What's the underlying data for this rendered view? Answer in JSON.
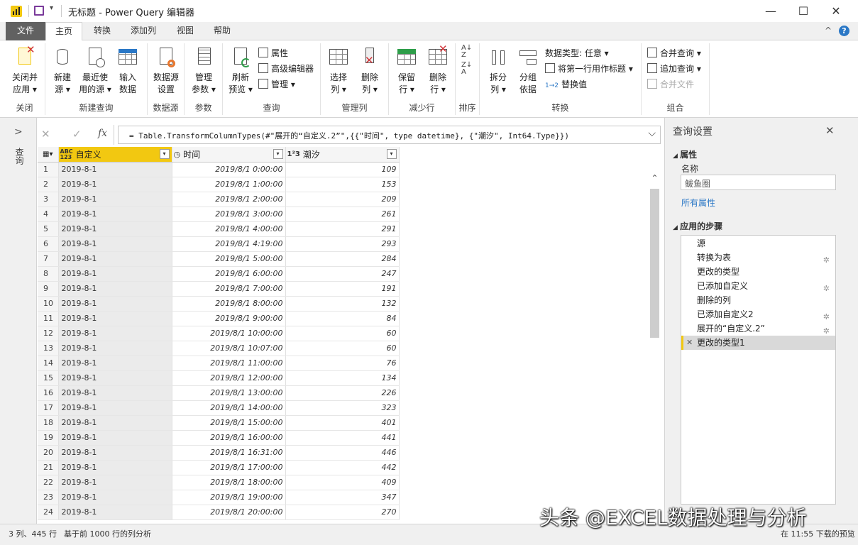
{
  "window": {
    "title": "无标题 - Power Query 编辑器",
    "controls": {
      "minimize": "—",
      "maximize": "☐",
      "close": "✕"
    }
  },
  "menu": {
    "tabs": [
      "文件",
      "主页",
      "转换",
      "添加列",
      "视图",
      "帮助"
    ],
    "active": "主页",
    "collapse": "^",
    "help": "?"
  },
  "ribbon": {
    "groups": {
      "close": "关闭",
      "new_query": "新建查询",
      "data_source": "数据源",
      "parameters": "参数",
      "query": "查询",
      "manage_columns": "管理列",
      "reduce_rows": "减少行",
      "sort": "排序",
      "transform": "转换",
      "combine": "组合"
    },
    "buttons": {
      "close_apply": [
        "关闭并",
        "应用 ▾"
      ],
      "new_source": [
        "新建",
        "源 ▾"
      ],
      "recent_sources": [
        "最近使",
        "用的源 ▾"
      ],
      "enter_data": [
        "输入",
        "数据"
      ],
      "data_source_settings": [
        "数据源",
        "设置"
      ],
      "manage_parameters": [
        "管理",
        "参数 ▾"
      ],
      "refresh_preview": [
        "刷新",
        "预览 ▾"
      ],
      "properties": "属性",
      "advanced_editor": "高级编辑器",
      "manage": "管理 ▾",
      "choose_columns": [
        "选择",
        "列 ▾"
      ],
      "remove_columns": [
        "删除",
        "列 ▾"
      ],
      "keep_rows": [
        "保留",
        "行 ▾"
      ],
      "remove_rows": [
        "删除",
        "行 ▾"
      ],
      "split_column": [
        "拆分",
        "列 ▾"
      ],
      "group_by": [
        "分组",
        "依据"
      ],
      "data_type": "数据类型: 任意 ▾",
      "first_row_headers": "将第一行用作标题 ▾",
      "replace_values": "替换值",
      "merge_queries": "合并查询 ▾",
      "append_queries": "追加查询 ▾",
      "combine_files": "合并文件"
    }
  },
  "formula_bar": {
    "cancel": "✕",
    "commit": "✓",
    "fx": "fx",
    "text": "= Table.TransformColumnTypes(#\"展开的“自定义.2”\",{{\"时间\", type datetime}, {\"潮汐\", Int64.Type}})",
    "expand": "⌵"
  },
  "left_pane": {
    "expand": ">",
    "label": "查询"
  },
  "grid": {
    "columns": [
      {
        "name": "自定义",
        "type": "ABC\n123"
      },
      {
        "name": "时间",
        "type": "◷"
      },
      {
        "name": "潮汐",
        "type": "1²3"
      }
    ],
    "rows": [
      [
        "1",
        "2019-8-1",
        "2019/8/1 0:00:00",
        "109"
      ],
      [
        "2",
        "2019-8-1",
        "2019/8/1 1:00:00",
        "153"
      ],
      [
        "3",
        "2019-8-1",
        "2019/8/1 2:00:00",
        "209"
      ],
      [
        "4",
        "2019-8-1",
        "2019/8/1 3:00:00",
        "261"
      ],
      [
        "5",
        "2019-8-1",
        "2019/8/1 4:00:00",
        "291"
      ],
      [
        "6",
        "2019-8-1",
        "2019/8/1 4:19:00",
        "293"
      ],
      [
        "7",
        "2019-8-1",
        "2019/8/1 5:00:00",
        "284"
      ],
      [
        "8",
        "2019-8-1",
        "2019/8/1 6:00:00",
        "247"
      ],
      [
        "9",
        "2019-8-1",
        "2019/8/1 7:00:00",
        "191"
      ],
      [
        "10",
        "2019-8-1",
        "2019/8/1 8:00:00",
        "132"
      ],
      [
        "11",
        "2019-8-1",
        "2019/8/1 9:00:00",
        "84"
      ],
      [
        "12",
        "2019-8-1",
        "2019/8/1 10:00:00",
        "60"
      ],
      [
        "13",
        "2019-8-1",
        "2019/8/1 10:07:00",
        "60"
      ],
      [
        "14",
        "2019-8-1",
        "2019/8/1 11:00:00",
        "76"
      ],
      [
        "15",
        "2019-8-1",
        "2019/8/1 12:00:00",
        "134"
      ],
      [
        "16",
        "2019-8-1",
        "2019/8/1 13:00:00",
        "226"
      ],
      [
        "17",
        "2019-8-1",
        "2019/8/1 14:00:00",
        "323"
      ],
      [
        "18",
        "2019-8-1",
        "2019/8/1 15:00:00",
        "401"
      ],
      [
        "19",
        "2019-8-1",
        "2019/8/1 16:00:00",
        "441"
      ],
      [
        "20",
        "2019-8-1",
        "2019/8/1 16:31:00",
        "446"
      ],
      [
        "21",
        "2019-8-1",
        "2019/8/1 17:00:00",
        "442"
      ],
      [
        "22",
        "2019-8-1",
        "2019/8/1 18:00:00",
        "409"
      ],
      [
        "23",
        "2019-8-1",
        "2019/8/1 19:00:00",
        "347"
      ],
      [
        "24",
        "2019-8-1",
        "2019/8/1 20:00:00",
        "270"
      ]
    ]
  },
  "settings": {
    "title": "查询设置",
    "close": "✕",
    "properties_header": "属性",
    "name_label": "名称",
    "name_value": "鲅鱼圈",
    "all_properties": "所有属性",
    "steps_header": "应用的步骤",
    "steps": [
      {
        "label": "源",
        "gear": false
      },
      {
        "label": "转换为表",
        "gear": true
      },
      {
        "label": "更改的类型",
        "gear": false
      },
      {
        "label": "已添加自定义",
        "gear": true
      },
      {
        "label": "删除的列",
        "gear": false
      },
      {
        "label": "已添加自定义2",
        "gear": true
      },
      {
        "label": "展开的“自定义.2”",
        "gear": true
      },
      {
        "label": "更改的类型1",
        "gear": false,
        "selected": true
      }
    ]
  },
  "status": {
    "left1": "3 列、445 行",
    "left2": "基于前 1000 行的列分析",
    "right": "在 11:55 下载的预览"
  },
  "watermark": "头条 @EXCEL数据处理与分析",
  "colors": {
    "accent": "#f2c811",
    "file_tab": "#616161",
    "link": "#2b78c6"
  }
}
